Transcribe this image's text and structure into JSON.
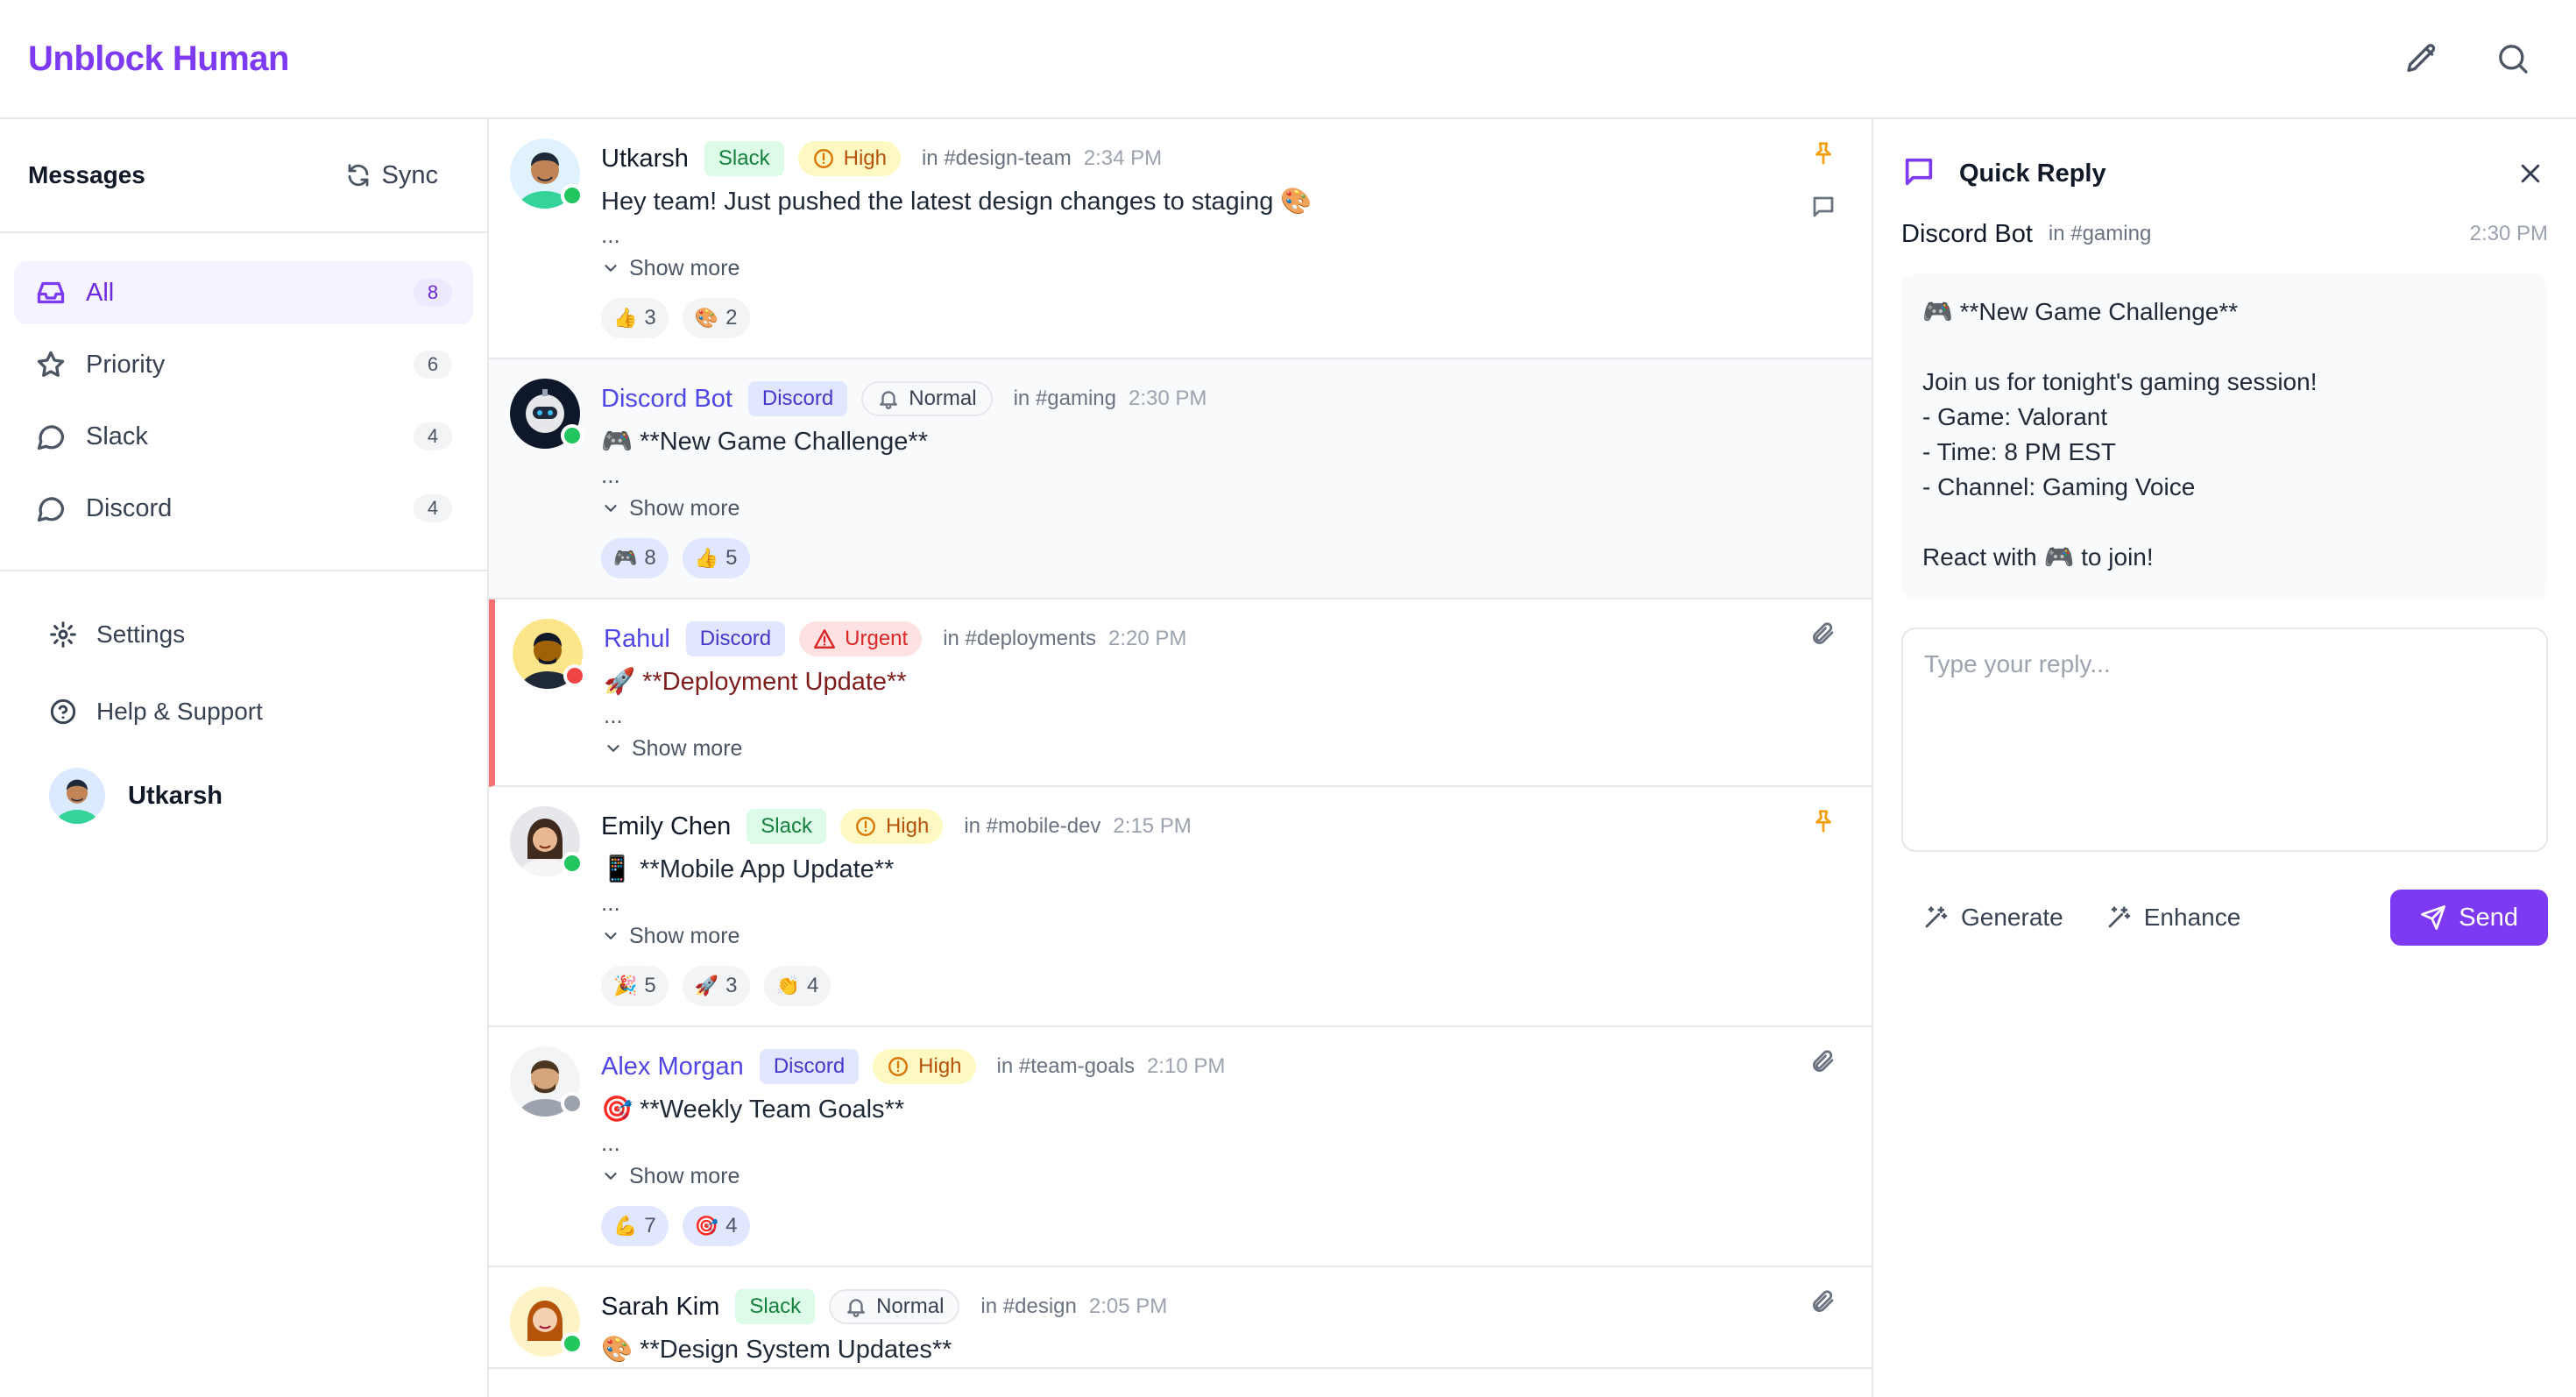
{
  "app": {
    "title": "Unblock Human"
  },
  "toolbar": {
    "compose_icon": "pencil-icon",
    "search_icon": "search-icon"
  },
  "sidebar": {
    "title": "Messages",
    "sync_label": "Sync",
    "items": [
      {
        "label": "All",
        "count": "8",
        "icon": "inbox-icon",
        "active": true
      },
      {
        "label": "Priority",
        "count": "6",
        "icon": "star-icon"
      },
      {
        "label": "Slack",
        "count": "4",
        "icon": "chat-bubble-icon"
      },
      {
        "label": "Discord",
        "count": "4",
        "icon": "chat-bubble-icon"
      }
    ],
    "settings_label": "Settings",
    "help_label": "Help & Support",
    "user_name": "Utkarsh"
  },
  "messages": [
    {
      "sender": "Utkarsh",
      "platform": "Slack",
      "priority": "High",
      "channel": "in #design-team",
      "time": "2:34 PM",
      "text": "Hey team! Just pushed the latest design changes to staging 🎨",
      "ellipsis": "...",
      "show_more": "Show more",
      "reactions": [
        {
          "emoji": "👍",
          "count": "3"
        },
        {
          "emoji": "🎨",
          "count": "2"
        }
      ],
      "status": "online"
    },
    {
      "sender": "Discord Bot",
      "platform": "Discord",
      "priority": "Normal",
      "channel": "in #gaming",
      "time": "2:30 PM",
      "text": "🎮 **New Game Challenge**",
      "ellipsis": "...",
      "show_more": "Show more",
      "reactions": [
        {
          "emoji": "🎮",
          "count": "8"
        },
        {
          "emoji": "👍",
          "count": "5"
        }
      ],
      "status": "online"
    },
    {
      "sender": "Rahul",
      "platform": "Discord",
      "priority": "Urgent",
      "channel": "in #deployments",
      "time": "2:20 PM",
      "text": "🚀 **Deployment Update**",
      "ellipsis": "...",
      "show_more": "Show more",
      "reactions": [],
      "status": "busy"
    },
    {
      "sender": "Emily Chen",
      "platform": "Slack",
      "priority": "High",
      "channel": "in #mobile-dev",
      "time": "2:15 PM",
      "text": "📱 **Mobile App Update**",
      "ellipsis": "...",
      "show_more": "Show more",
      "reactions": [
        {
          "emoji": "🎉",
          "count": "5"
        },
        {
          "emoji": "🚀",
          "count": "3"
        },
        {
          "emoji": "👏",
          "count": "4"
        }
      ],
      "status": "online"
    },
    {
      "sender": "Alex Morgan",
      "platform": "Discord",
      "priority": "High",
      "channel": "in #team-goals",
      "time": "2:10 PM",
      "text": "🎯 **Weekly Team Goals**",
      "ellipsis": "...",
      "show_more": "Show more",
      "reactions": [
        {
          "emoji": "💪",
          "count": "7"
        },
        {
          "emoji": "🎯",
          "count": "4"
        }
      ],
      "status": "offline"
    },
    {
      "sender": "Sarah Kim",
      "platform": "Slack",
      "priority": "Normal",
      "channel": "in #design",
      "time": "2:05 PM",
      "text": "🎨 **Design System Updates**",
      "ellipsis": "",
      "show_more": "",
      "reactions": [],
      "status": "online"
    }
  ],
  "panel": {
    "title": "Quick Reply",
    "sender": "Discord Bot",
    "channel": "in #gaming",
    "time": "2:30 PM",
    "quote_lines": [
      "🎮 **New Game Challenge**",
      "",
      "Join us for tonight's gaming session!",
      "- Game: Valorant",
      "- Time: 8 PM EST",
      "- Channel: Gaming Voice",
      "",
      "React with 🎮 to join!"
    ],
    "reply_placeholder": "Type your reply...",
    "generate_label": "Generate",
    "enhance_label": "Enhance",
    "send_label": "Send"
  },
  "colors": {
    "brand": "#7e3af2",
    "online": "#22c55e",
    "busy": "#ef4444",
    "offline": "#9ca3af",
    "urgent_border": "#f87171"
  }
}
